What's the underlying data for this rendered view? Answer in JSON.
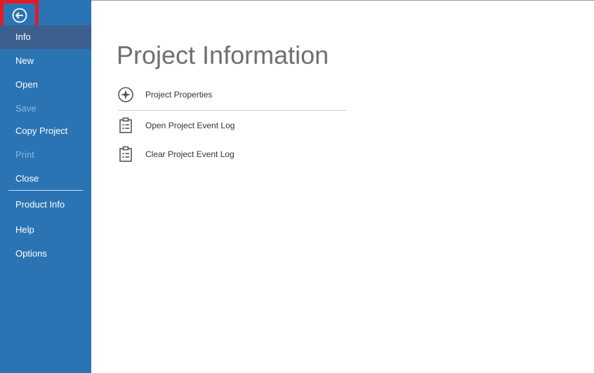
{
  "sidebar": {
    "back": {
      "icon": "arrow-left-circle-icon",
      "highlight_color": "#e41b23"
    },
    "items": [
      {
        "label": "Info",
        "state": "selected"
      },
      {
        "label": "New",
        "state": "enabled"
      },
      {
        "label": "Open",
        "state": "enabled"
      },
      {
        "label": "Save",
        "state": "disabled"
      },
      {
        "label": "Copy Project",
        "state": "enabled"
      },
      {
        "label": "Print",
        "state": "disabled"
      },
      {
        "label": "Close",
        "state": "enabled"
      },
      {
        "label": "Product Info",
        "state": "enabled"
      },
      {
        "label": "Help",
        "state": "enabled"
      },
      {
        "label": "Options",
        "state": "enabled"
      }
    ],
    "background_color": "#2a74b4",
    "selected_color": "#3b5f8f"
  },
  "main": {
    "title": "Project Information",
    "actions": [
      {
        "label": "Project Properties",
        "icon": "compass-star-icon"
      },
      {
        "label": "Open Project Event Log",
        "icon": "clipboard-list-icon"
      },
      {
        "label": "Clear Project Event Log",
        "icon": "clipboard-list-icon"
      }
    ]
  }
}
